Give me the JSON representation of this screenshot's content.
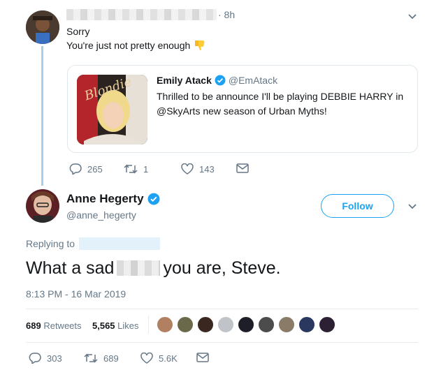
{
  "reply_tweet": {
    "time": "· 8h",
    "line1": "Sorry",
    "line2": "You're just not pretty enough",
    "emoji_icon": "thumbs-down-icon",
    "quoted": {
      "author_name": "Emily Atack",
      "handle": "@EmAtack",
      "text_line1": "Thrilled to be announce I'll be playing DEBBIE HARRY in",
      "text_line2": "@SkyArts new season of Urban Myths!",
      "image_text": "Blondie"
    },
    "actions": {
      "replies": "265",
      "retweets": "1",
      "likes": "143"
    }
  },
  "main_tweet": {
    "author_name": "Anne Hegerty",
    "handle": "@anne_hegerty",
    "follow_label": "Follow",
    "replying_to_label": "Replying to",
    "text_before": "What a sad",
    "text_after": "you are, Steve.",
    "timestamp": "8:13 PM - 16 Mar 2019",
    "retweets_count": "689",
    "retweets_label": "Retweets",
    "likes_count": "5,565",
    "likes_label": "Likes",
    "actions": {
      "replies": "303",
      "retweets": "689",
      "likes": "5.6K"
    }
  },
  "colors": {
    "accent": "#1da1f2",
    "muted": "#657786",
    "thread": "#a6d0f0"
  }
}
